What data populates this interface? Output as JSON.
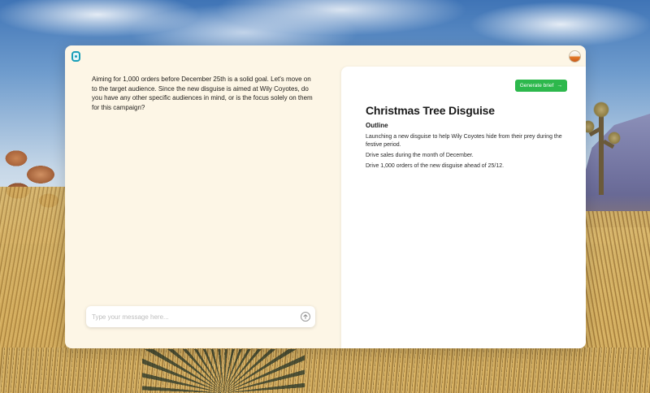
{
  "chat": {
    "message": "Aiming for 1,000 orders before December 25th is a solid goal. Let's move on to the target audience. Since the new disguise is aimed at Wily Coyotes, do you have any other specific audiences in mind, or is the focus solely on them for this campaign?",
    "input_placeholder": "Type your message here...",
    "input_value": ""
  },
  "brief": {
    "generate_label": "Generate brief",
    "generate_icon": "arrow-right-icon",
    "title": "Christmas Tree Disguise",
    "subheading": "Outline",
    "points": [
      "Launching a new disguise to help Wily Coyotes hide from their prey during the festive period.",
      "Drive sales during the month of December.",
      "Drive 1,000 orders of the new disguise ahead of 25/12."
    ]
  },
  "colors": {
    "accent": "#2db84c",
    "window_bg": "#fdf6e6",
    "logo": "#1a9fb8"
  }
}
